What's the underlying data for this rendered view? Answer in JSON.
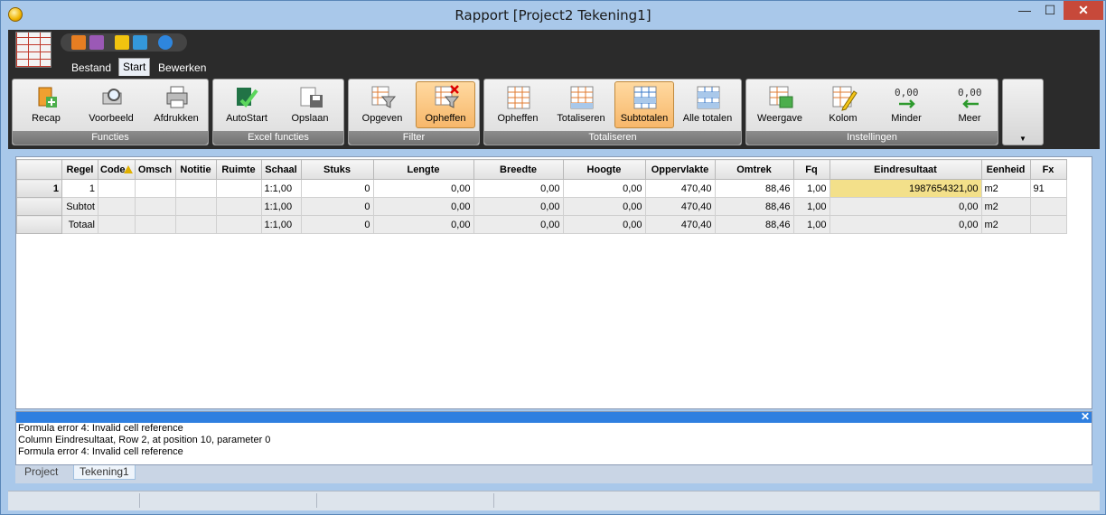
{
  "window": {
    "title": "Rapport  [Project2 Tekening1]",
    "min_glyph": "—",
    "max_glyph": "☐",
    "close_glyph": "✕"
  },
  "tabs": [
    {
      "label": "Bestand",
      "active": false
    },
    {
      "label": "Start",
      "active": true
    },
    {
      "label": "Bewerken",
      "active": false
    }
  ],
  "groups": {
    "functies": {
      "label": "Functies",
      "buttons": [
        "Recap",
        "Voorbeeld",
        "Afdrukken"
      ]
    },
    "excel": {
      "label": "Excel functies",
      "buttons": [
        "AutoStart",
        "Opslaan"
      ]
    },
    "filter": {
      "label": "Filter",
      "buttons": [
        "Opgeven",
        "Opheffen"
      ]
    },
    "totaliseren": {
      "label": "Totaliseren",
      "buttons": [
        "Opheffen",
        "Totaliseren",
        "Subtotalen",
        "Alle totalen"
      ]
    },
    "instellingen": {
      "label": "Instellingen",
      "buttons": [
        "Weergave",
        "Kolom",
        "Minder",
        "Meer"
      ]
    }
  },
  "grid": {
    "columns": [
      "",
      "Regel",
      "Code",
      "Omsch",
      "Notitie",
      "Ruimte",
      "Schaal",
      "Stuks",
      "Lengte",
      "Breedte",
      "Hoogte",
      "Oppervlakte",
      "Omtrek",
      "Fq",
      "Eindresultaat",
      "Eenheid",
      "Fx"
    ],
    "rows": [
      {
        "hdr": "1",
        "regel": "1",
        "code": "",
        "omsch": "",
        "notitie": "",
        "ruimte": "",
        "schaal": "1:1,00",
        "stuks": "0",
        "lengte": "0,00",
        "breedte": "0,00",
        "hoogte": "0,00",
        "oppervlakte": "470,40",
        "omtrek": "88,46",
        "fq": "1,00",
        "eindresultaat": "1987654321,00",
        "eenheid": "m2",
        "fx": "91"
      },
      {
        "hdr": "",
        "regel": "Subtot",
        "code": "",
        "omsch": "",
        "notitie": "",
        "ruimte": "",
        "schaal": "1:1,00",
        "stuks": "0",
        "lengte": "0,00",
        "breedte": "0,00",
        "hoogte": "0,00",
        "oppervlakte": "470,40",
        "omtrek": "88,46",
        "fq": "1,00",
        "eindresultaat": "0,00",
        "eenheid": "m2",
        "fx": ""
      },
      {
        "hdr": "",
        "regel": "Totaal",
        "code": "",
        "omsch": "",
        "notitie": "",
        "ruimte": "",
        "schaal": "1:1,00",
        "stuks": "0",
        "lengte": "0,00",
        "breedte": "0,00",
        "hoogte": "0,00",
        "oppervlakte": "470,40",
        "omtrek": "88,46",
        "fq": "1,00",
        "eindresultaat": "0,00",
        "eenheid": "m2",
        "fx": ""
      }
    ]
  },
  "messages": {
    "close_glyph": "✕",
    "lines": [
      "Formula error 4: Invalid cell reference",
      "Column Eindresultaat, Row 2, at position 10, parameter 0",
      "Formula error 4: Invalid cell reference"
    ]
  },
  "sheet_tabs": [
    {
      "label": "Project",
      "active": false
    },
    {
      "label": "Tekening1",
      "active": true
    }
  ],
  "icons": {
    "app": "app-orb-icon",
    "selected_cell_color": "#f3e08a",
    "accent_pressed": "#f7b76a"
  }
}
